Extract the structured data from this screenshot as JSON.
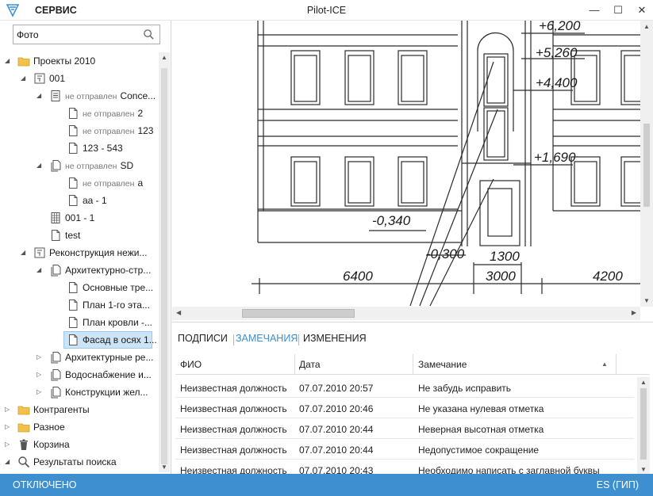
{
  "titlebar": {
    "menu_service": "СЕРВИС",
    "window_title": "Pilot-ICE",
    "minimize": "—",
    "maximize": "☐",
    "close": "✕"
  },
  "search": {
    "value": "Фото",
    "placeholder": ""
  },
  "tree": [
    {
      "label": "Проекты 2010",
      "status": "",
      "icon": "folder-icon",
      "expanded": true
    },
    {
      "label": "001",
      "status": "",
      "icon": "project-icon",
      "expanded": true
    },
    {
      "label": "Conce...",
      "status": "не отправлен",
      "icon": "document-list-icon",
      "expanded": true
    },
    {
      "label": "2",
      "status": "не отправлен",
      "icon": "document-icon"
    },
    {
      "label": "123",
      "status": "не отправлен",
      "icon": "document-icon"
    },
    {
      "label": "123 - 543",
      "status": "",
      "icon": "document-icon"
    },
    {
      "label": "SD",
      "status": "не отправлен",
      "icon": "document-stack-icon",
      "expanded": true
    },
    {
      "label": "a",
      "status": "не отправлен",
      "icon": "document-icon"
    },
    {
      "label": "аа - 1",
      "status": "",
      "icon": "document-icon"
    },
    {
      "label": "001 - 1",
      "status": "",
      "icon": "table-icon"
    },
    {
      "label": "test",
      "status": "",
      "icon": "document-icon"
    },
    {
      "label": "Реконструкция нежи...",
      "status": "",
      "icon": "project-icon",
      "expanded": true
    },
    {
      "label": "Архитектурно-стр...",
      "status": "",
      "icon": "document-stack-icon",
      "expanded": true
    },
    {
      "label": "Основные тре...",
      "status": "",
      "icon": "document-icon"
    },
    {
      "label": "План 1-го эта...",
      "status": "",
      "icon": "document-icon"
    },
    {
      "label": "План кровли -...",
      "status": "",
      "icon": "document-icon"
    },
    {
      "label": "Фасад в осях 1...",
      "status": "",
      "icon": "document-icon",
      "selected": true
    },
    {
      "label": "Архитектурные ре...",
      "status": "",
      "icon": "document-stack-icon",
      "expanded": false
    },
    {
      "label": "Водоснабжение и...",
      "status": "",
      "icon": "document-stack-icon",
      "expanded": false
    },
    {
      "label": "Конструкции жел...",
      "status": "",
      "icon": "document-stack-icon",
      "expanded": false
    },
    {
      "label": "Контрагенты",
      "status": "",
      "icon": "folder-icon",
      "expanded": false
    },
    {
      "label": "Разное",
      "status": "",
      "icon": "folder-icon",
      "expanded": false
    },
    {
      "label": "Корзина",
      "status": "",
      "icon": "trash-icon",
      "expanded": false
    },
    {
      "label": "Результаты поиска",
      "status": "",
      "icon": "search-results-icon",
      "expanded": true
    }
  ],
  "drawing": {
    "levels": [
      "+6,200",
      "+5,260",
      "+4,400",
      "+1,690",
      "-0,340",
      "-0,300"
    ],
    "dimensions": [
      "6400",
      "1300",
      "3000",
      "4200"
    ]
  },
  "tabs": [
    {
      "label": "ПОДПИСИ",
      "active": false
    },
    {
      "label": "ЗАМЕЧАНИЯ",
      "active": true
    },
    {
      "label": "ИЗМЕНЕНИЯ",
      "active": false
    }
  ],
  "grid": {
    "columns": [
      "ФИО",
      "Дата",
      "Замечание"
    ],
    "rows": [
      [
        "Неизвестная должность",
        "07.07.2010 20:57",
        "Не забудь исправить"
      ],
      [
        "Неизвестная должность",
        "07.07.2010 20:46",
        "Не указана нулевая отметка"
      ],
      [
        "Неизвестная должность",
        "07.07.2010 20:44",
        "Неверная высотная отметка"
      ],
      [
        "Неизвестная должность",
        "07.07.2010 20:44",
        "Недопустимое сокращение"
      ],
      [
        "Неизвестная должность",
        "07.07.2010 20:43",
        "Необходимо написать с заглавной буквы"
      ]
    ]
  },
  "status": {
    "left": "ОТКЛЮЧЕНО",
    "right": "ES (ГИП)"
  },
  "colors": {
    "accent": "#3d8fd0",
    "tab_active": "#3c8fd1",
    "selection": "#cde4f7"
  }
}
